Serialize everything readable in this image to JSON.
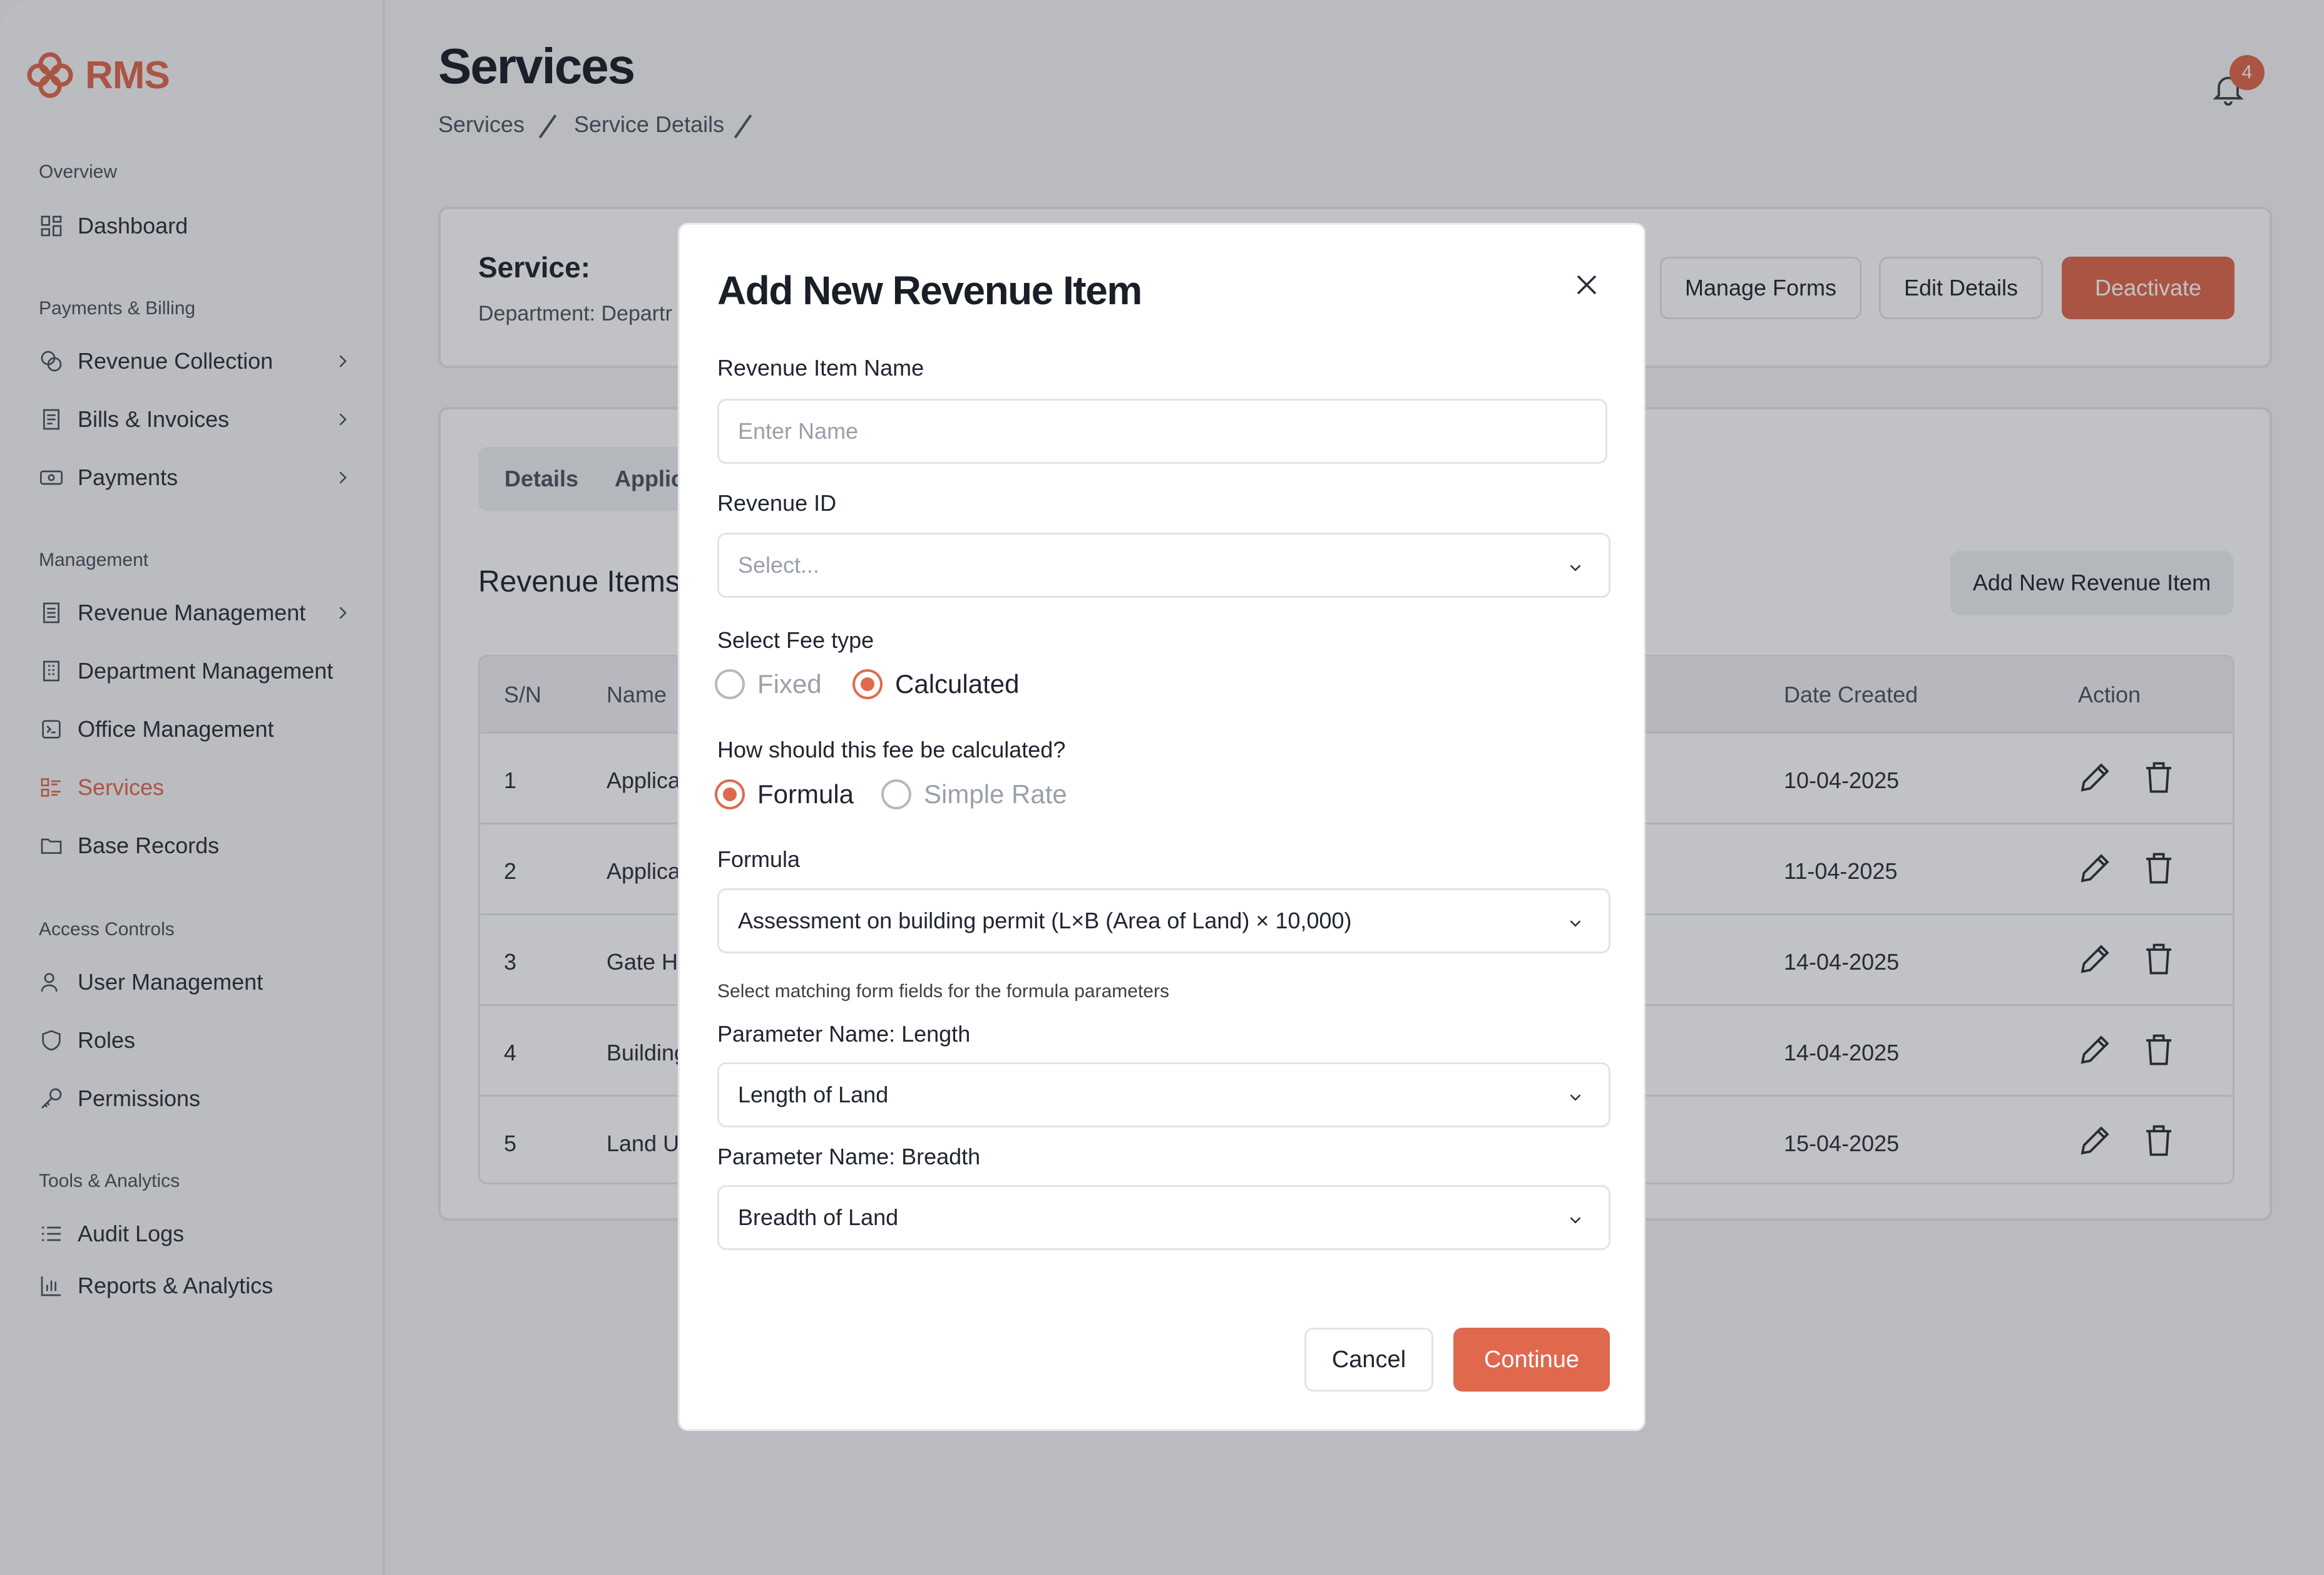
{
  "brand": {
    "name": "RMS",
    "color": "#e0694d"
  },
  "sidebar": {
    "sections": [
      {
        "title": "Overview"
      },
      {
        "title": "Payments & Billing"
      },
      {
        "title": "Management"
      },
      {
        "title": "Access Controls"
      },
      {
        "title": "Tools & Analytics"
      }
    ],
    "items": [
      {
        "label": "Dashboard",
        "icon": "dashboard-icon"
      },
      {
        "label": "Revenue Collection",
        "icon": "coins-icon",
        "has_submenu": true
      },
      {
        "label": "Bills & Invoices",
        "icon": "receipt-icon",
        "has_submenu": true
      },
      {
        "label": "Payments",
        "icon": "banknote-icon",
        "has_submenu": true
      },
      {
        "label": "Revenue Management",
        "icon": "document-icon",
        "has_submenu": true
      },
      {
        "label": "Department Management",
        "icon": "building-icon"
      },
      {
        "label": "Office Management",
        "icon": "office-icon"
      },
      {
        "label": "Services",
        "icon": "services-icon",
        "active": true
      },
      {
        "label": "Base Records",
        "icon": "folder-icon"
      },
      {
        "label": "User Management",
        "icon": "user-icon"
      },
      {
        "label": "Roles",
        "icon": "shield-icon"
      },
      {
        "label": "Permissions",
        "icon": "key-icon"
      },
      {
        "label": "Audit Logs",
        "icon": "list-icon"
      },
      {
        "label": "Reports & Analytics",
        "icon": "bar-chart-icon"
      }
    ]
  },
  "header": {
    "title": "Services",
    "breadcrumb": [
      "Services",
      "Service Details"
    ],
    "notifications": "4"
  },
  "service_card": {
    "label": "Service:",
    "department": "Department: Departr",
    "buttons": {
      "manage_forms": "Manage Forms",
      "edit_details": "Edit Details",
      "deactivate": "Deactivate"
    }
  },
  "tabs": [
    "Details",
    "Applic"
  ],
  "revenue_items": {
    "title": "Revenue Items",
    "add_button": "Add New Revenue Item",
    "columns": [
      "S/N",
      "Name",
      "Date Created",
      "Action"
    ],
    "rows": [
      {
        "sn": "1",
        "name": "Applica",
        "date": "10-04-2025"
      },
      {
        "sn": "2",
        "name": "Applica",
        "date": "11-04-2025"
      },
      {
        "sn": "3",
        "name": "Gate Hc",
        "date": "14-04-2025"
      },
      {
        "sn": "4",
        "name": "Building",
        "date": "14-04-2025"
      },
      {
        "sn": "5",
        "name": "Land Us",
        "date": "15-04-2025"
      }
    ]
  },
  "modal": {
    "title": "Add New Revenue Item",
    "name_label": "Revenue Item Name",
    "name_placeholder": "Enter Name",
    "revenue_id_label": "Revenue ID",
    "revenue_id_placeholder": "Select...",
    "fee_type_label": "Select Fee type",
    "fee_types": [
      {
        "label": "Fixed",
        "selected": false
      },
      {
        "label": "Calculated",
        "selected": true
      }
    ],
    "calc_label": "How should this fee be calculated?",
    "calc_methods": [
      {
        "label": "Formula",
        "selected": true
      },
      {
        "label": "Simple Rate",
        "selected": false
      }
    ],
    "formula_label": "Formula",
    "formula_value": "Assessment on building permit (L×B (Area of Land) × 10,000)",
    "helper_text": "Select matching form fields for the formula parameters",
    "param1_label": "Parameter Name: Length",
    "param1_value": "Length of Land",
    "param2_label": "Parameter Name: Breadth",
    "param2_value": "Breadth of Land",
    "cancel": "Cancel",
    "continue": "Continue"
  }
}
